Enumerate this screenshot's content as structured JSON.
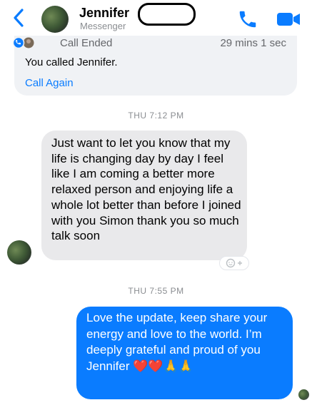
{
  "header": {
    "name": "Jennifer",
    "subtitle": "Messenger",
    "icons": [
      "back-chevron-icon",
      "phone-icon",
      "video-camera-icon"
    ],
    "accent_color": "#0a7cff"
  },
  "call_card": {
    "status": "Call Ended",
    "duration": "29 mins 1 sec",
    "description": "You called Jennifer.",
    "action": "Call Again"
  },
  "messages": [
    {
      "timestamp": "THU 7:12 PM",
      "direction": "incoming",
      "text": "Just want to let you know that my life is changing day by day I feel like I am coming a better more relaxed person and enjoying life a whole lot better than before I joined with you Simon thank you so much talk soon"
    },
    {
      "timestamp": "THU 7:55 PM",
      "direction": "outgoing",
      "text": "Love the update, keep share your energy and love to the world. I’m deeply grateful and proud of you Jennifer ❤️❤️🙏🙏"
    }
  ],
  "colors": {
    "incoming_bubble": "#e9e9eb",
    "outgoing_bubble": "#0a7cff",
    "call_card_bg": "#f0f2f5"
  }
}
